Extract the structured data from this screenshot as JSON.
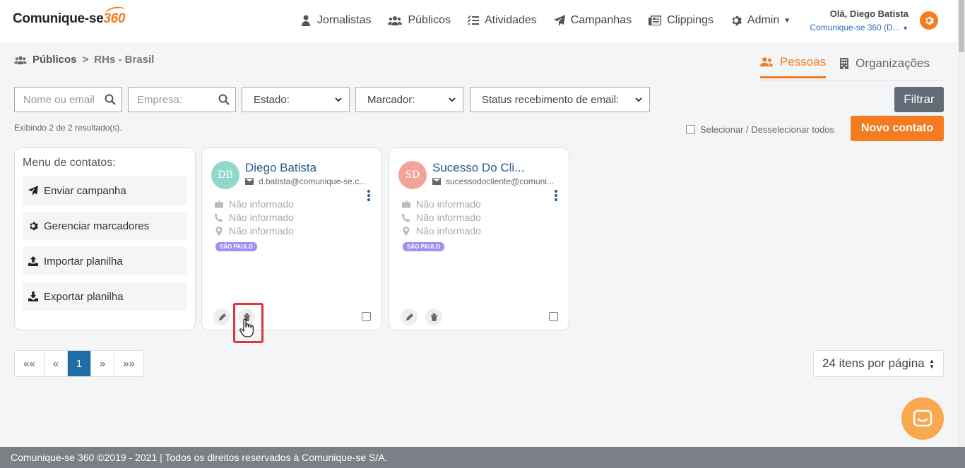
{
  "header": {
    "logo_text": "Comunique-se",
    "logo_num": "360",
    "nav": [
      {
        "label": "Jornalistas"
      },
      {
        "label": "Públicos"
      },
      {
        "label": "Atividades"
      },
      {
        "label": "Campanhas"
      },
      {
        "label": "Clippings"
      },
      {
        "label": "Admin"
      }
    ],
    "greeting": "Olá, Diego Batista",
    "company": "Comunique-se 360 (D...",
    "accent": "#f47b20"
  },
  "breadcrumb": {
    "root": "Públicos",
    "current": "RHs - Brasil"
  },
  "tabs": [
    {
      "label": "Pessoas",
      "active": true
    },
    {
      "label": "Organizações",
      "active": false
    }
  ],
  "filters": {
    "name_placeholder": "Nome ou email",
    "company_placeholder": "Empresa:",
    "state": "Estado:",
    "tag": "Marcador:",
    "email_status": "Status recebimento de email:",
    "button": "Filtrar"
  },
  "results_text": "Exibindo 2 de 2 resultado(s).",
  "select_all_label": "Selecionar / Desselecionar todos",
  "new_contact": "Novo contato",
  "menu": {
    "title": "Menu de contatos:",
    "items": [
      {
        "label": "Enviar campanha",
        "icon": "paper-plane-icon"
      },
      {
        "label": "Gerenciar marcadores",
        "icon": "gear-icon"
      },
      {
        "label": "Importar planilha",
        "icon": "upload-icon"
      },
      {
        "label": "Exportar planilha",
        "icon": "download-icon"
      }
    ]
  },
  "contacts": [
    {
      "initials": "DB",
      "avatar_color": "#8ed9cb",
      "name": "Diego Batista",
      "email": "d.batista@comunique-se.c...",
      "company": "Não informado",
      "phone": "Não informado",
      "location": "Não informado",
      "tag": "SÃO PAULO"
    },
    {
      "initials": "SD",
      "avatar_color": "#f3a49a",
      "name": "Sucesso Do Cli...",
      "email": "sucessodocliente@comuni...",
      "company": "Não informado",
      "phone": "Não informado",
      "location": "Não informado",
      "tag": "SÃO PAULO"
    }
  ],
  "pagination": {
    "first": "««",
    "prev": "«",
    "current": "1",
    "next": "»",
    "last": "»»",
    "per_page": "24 itens por página"
  },
  "footer": "Comunique-se 360 ©2019 - 2021 | Todos os direitos reservados à Comunique-se S/A."
}
